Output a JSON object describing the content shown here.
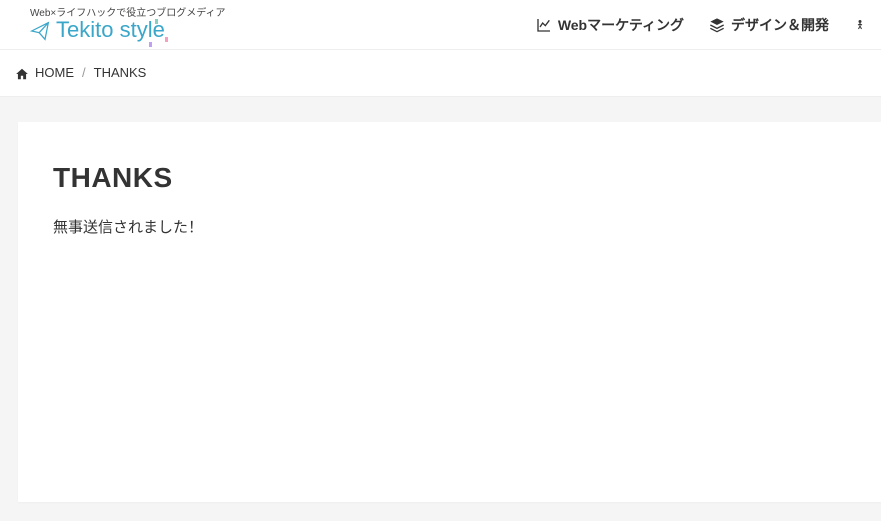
{
  "header": {
    "tagline": "Web×ライフハックで役立つブログメディア",
    "logo_text": "Tekito style"
  },
  "nav": {
    "items": [
      {
        "label": "Webマーケティング",
        "icon": "chart-line-icon"
      },
      {
        "label": "デザイン＆開発",
        "icon": "layers-icon"
      }
    ]
  },
  "breadcrumb": {
    "home_label": "HOME",
    "current_label": "THANKS"
  },
  "page": {
    "title": "THANKS",
    "body": "無事送信されました！"
  }
}
